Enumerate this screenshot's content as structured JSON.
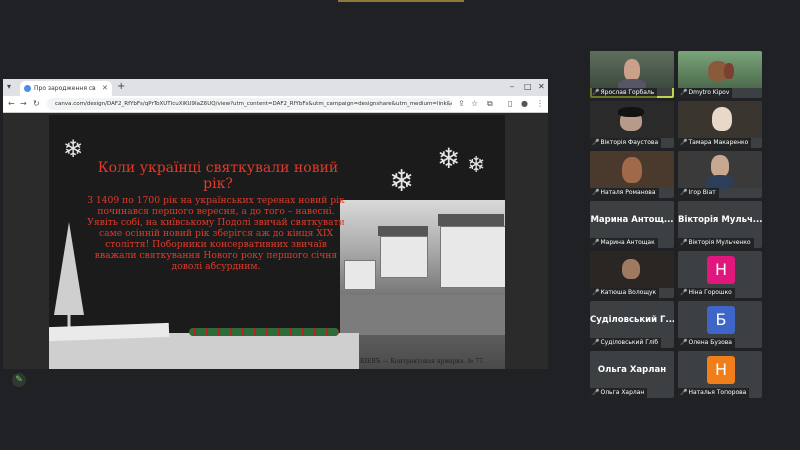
{
  "browser": {
    "tab_title": "Про зародження святкування",
    "url": "canva.com/design/DAF2_RfYbFs/qPrToXUTlcuXiKU9IaZ6UQ/view?utm_content=DAF2_RfYbFs&utm_campaign=designshare&utm_medium=link&utm_sou..."
  },
  "slide": {
    "title": "Коли українці святкували новий рік?",
    "body": "З 1409 по 1700 рік на українських теренах новий рік починався першого вересня, а до того – навесні. Уявіть собі, на київському Подолі звичай святкувати саме осінній новий рік зберігся аж до кінця XIX століття! Поборники консервативних звичаїв вважали святкування Нового року першого січня доволі абсурдним.",
    "photo_caption": "КІЕВЪ — Контрактовая ярмарка.   № 77."
  },
  "participants": [
    {
      "name": "Ярослав Горбаль",
      "kind": "video",
      "active": true
    },
    {
      "name": "Dmytro Kipov",
      "kind": "video"
    },
    {
      "name": "Вікторія Фаустова",
      "kind": "video"
    },
    {
      "name": "Тамара Макаренко",
      "kind": "video"
    },
    {
      "name": "Наталя Романова",
      "kind": "video"
    },
    {
      "name": "Ігор Віат",
      "kind": "video"
    },
    {
      "name": "Марина Антощ...",
      "caption": "Марина Антощак",
      "kind": "name"
    },
    {
      "name": "Вікторія Мульч...",
      "caption": "Вікторія Мульченко",
      "kind": "name"
    },
    {
      "name": "Катюша Волощук",
      "kind": "video"
    },
    {
      "name": "Ніна Горошко",
      "initial": "Н",
      "color": "#e0177d",
      "kind": "avatar"
    },
    {
      "name": "Суділовський Г...",
      "caption": "Суділовський Гліб",
      "kind": "name"
    },
    {
      "name": "Олена Бузова",
      "initial": "Б",
      "color": "#3f65c8",
      "kind": "avatar"
    },
    {
      "name": "Ольга Харлан",
      "caption": "Ольга Харлан",
      "kind": "name"
    },
    {
      "name": "Наталья Топорова",
      "initial": "Н",
      "color": "#f07f1b",
      "kind": "avatar"
    }
  ],
  "colors": {
    "accent_red": "#e03a2a",
    "active_outline": "#c4d44a",
    "mic_muted": "#e24b3b"
  }
}
